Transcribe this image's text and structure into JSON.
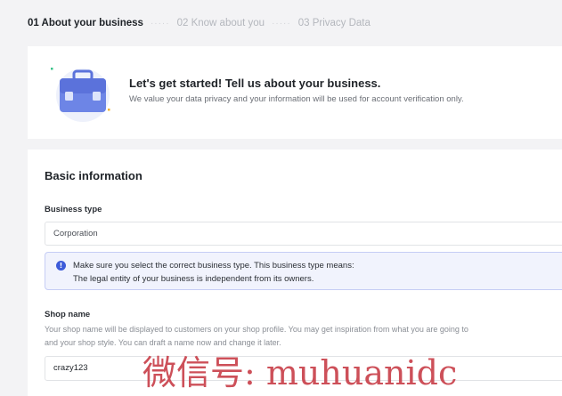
{
  "stepper": {
    "steps": [
      {
        "label": "01 About your business",
        "active": true
      },
      {
        "label": "02 Know about you",
        "active": false
      },
      {
        "label": "03 Privacy Data",
        "active": false
      }
    ],
    "separator": "·····"
  },
  "hero": {
    "icon": "briefcase-icon",
    "title": "Let's get started! Tell us about your business.",
    "subtitle": "We value your data privacy and your information will be used for account verification only."
  },
  "basic_info": {
    "title": "Basic information",
    "business_type": {
      "label": "Business type",
      "value": "Corporation"
    },
    "notice": {
      "icon": "info-icon",
      "icon_glyph": "!",
      "line1": "Make sure you select the correct business type. This business type means:",
      "line2": "The legal entity of your business is independent from its owners."
    },
    "shop_name": {
      "label": "Shop name",
      "help_line1": "Your shop name will be displayed to customers on your shop profile. You may get inspiration from what you are going to",
      "help_line2": "and your shop style. You can draft a name now and change it later.",
      "value": "crazy123"
    }
  },
  "watermark": "微信号: muhuanidc",
  "colors": {
    "accent": "#3d5bd9",
    "notice_bg": "#f1f3fd",
    "notice_border": "#c6cdf5",
    "watermark": "#c9424c"
  }
}
